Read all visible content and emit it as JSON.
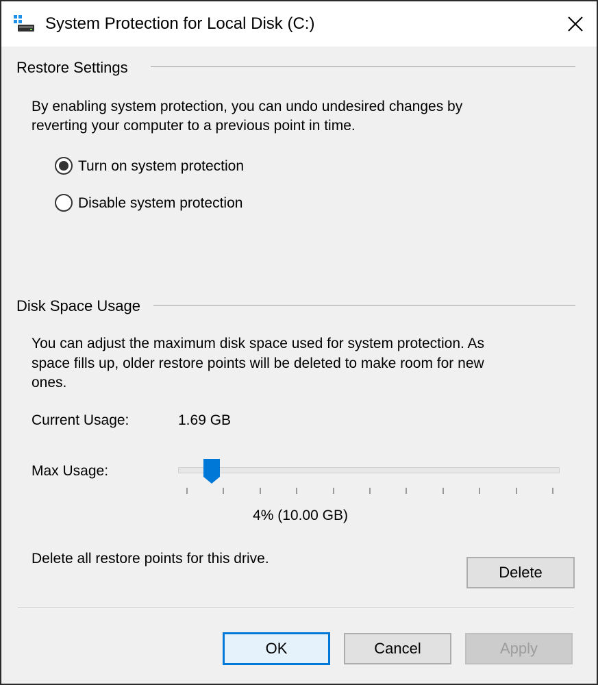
{
  "window": {
    "title": "System Protection for Local Disk (C:)",
    "icon": "drive-icon"
  },
  "restore_settings": {
    "label": "Restore Settings",
    "description_line1": "By enabling system protection, you can undo undesired changes by",
    "description_line2": "reverting your computer to a previous point in time.",
    "options": [
      {
        "label": "Turn on system protection",
        "checked": true
      },
      {
        "label": "Disable system protection",
        "checked": false
      }
    ]
  },
  "disk_space": {
    "label": "Disk Space Usage",
    "description_line1": "You can adjust the maximum disk space used for system protection. As",
    "description_line2": "space fills up, older restore points will be deleted to make room for new",
    "description_line3": "ones.",
    "current_usage_label": "Current Usage:",
    "current_usage_value": "1.69 GB",
    "max_usage_label": "Max Usage:",
    "max_usage_percent": 4,
    "max_usage_value": "4% (10.00 GB)",
    "delete_text": "Delete all restore points for this drive.",
    "delete_button": "Delete"
  },
  "buttons": {
    "ok": "OK",
    "cancel": "Cancel",
    "apply": "Apply"
  },
  "colors": {
    "accent": "#0078d7",
    "background": "#f0f0f0"
  }
}
